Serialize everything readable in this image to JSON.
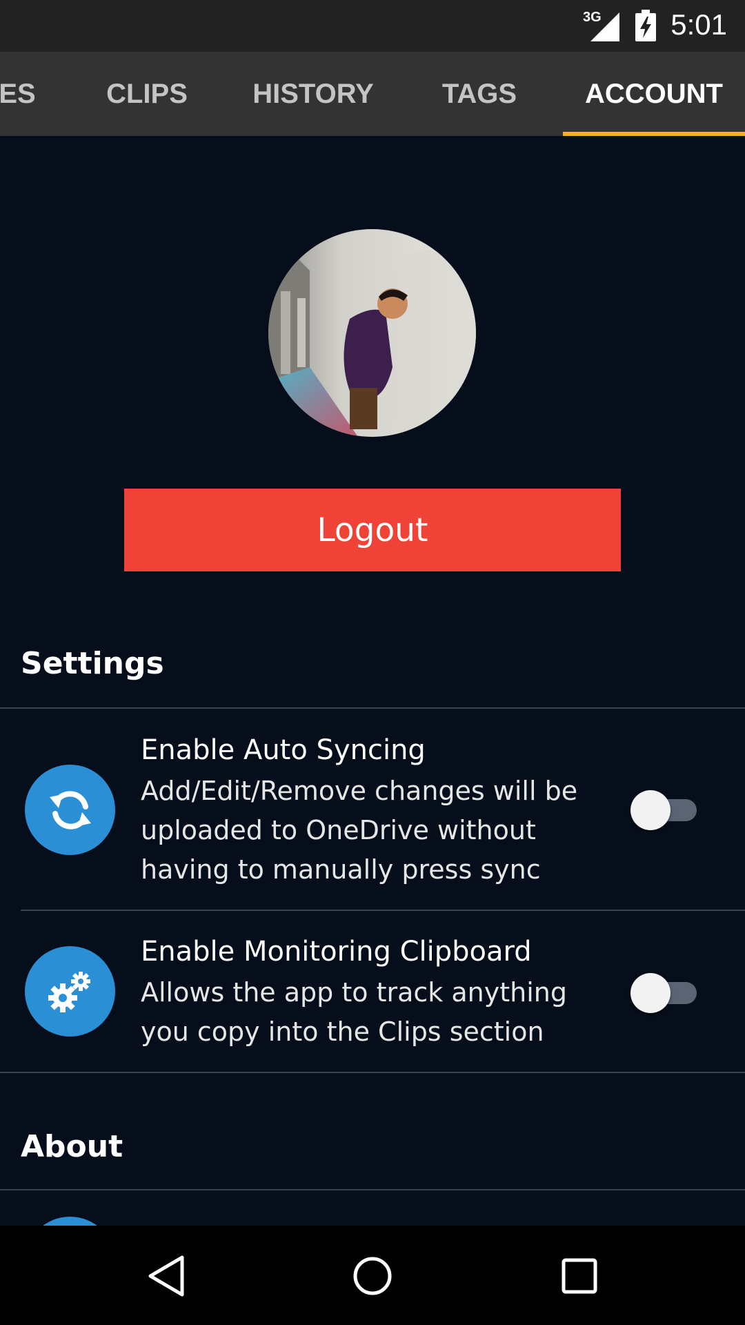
{
  "status_bar": {
    "network": "3G",
    "time": "5:01",
    "icons": [
      "signal-icon",
      "battery-charging-icon"
    ]
  },
  "tabs": [
    {
      "label": "ES",
      "active": false
    },
    {
      "label": "CLIPS",
      "active": false
    },
    {
      "label": "HISTORY",
      "active": false
    },
    {
      "label": "TAGS",
      "active": false
    },
    {
      "label": "ACCOUNT",
      "active": true
    }
  ],
  "account": {
    "logout_label": "Logout"
  },
  "settings": {
    "title": "Settings",
    "items": [
      {
        "title": "Enable Auto Syncing",
        "description": "Add/Edit/Remove changes will be uploaded to OneDrive without having to manually press sync",
        "icon": "sync-icon",
        "enabled": false
      },
      {
        "title": "Enable Monitoring Clipboard",
        "description": "Allows the app to track anything you copy into the Clips section",
        "icon": "gears-icon",
        "enabled": false
      }
    ]
  },
  "about": {
    "title": "About"
  },
  "nav_bar": {
    "icons": [
      "back-icon",
      "home-icon",
      "recents-icon"
    ]
  },
  "colors": {
    "background": "#050e1a",
    "tab_bar": "#333333",
    "tab_indicator": "#f5b324",
    "logout": "#ee4336",
    "icon_circle": "#2a8fd4"
  }
}
